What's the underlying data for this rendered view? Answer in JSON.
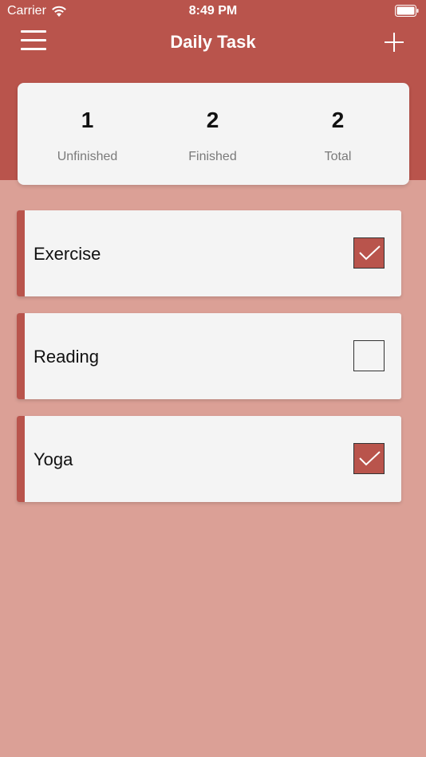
{
  "status_bar": {
    "carrier": "Carrier",
    "time": "8:49 PM"
  },
  "header": {
    "title": "Daily Task"
  },
  "summary": {
    "unfinished": {
      "count": "1",
      "label": "Unfinished"
    },
    "finished": {
      "count": "2",
      "label": "Finished"
    },
    "total": {
      "count": "2",
      "label": "Total"
    }
  },
  "tasks": [
    {
      "name": "Exercise",
      "done": true
    },
    {
      "name": "Reading",
      "done": false
    },
    {
      "name": "Yoga",
      "done": true
    }
  ],
  "colors": {
    "accent": "#b9544c",
    "background": "#dba096",
    "card": "#f4f4f4"
  }
}
